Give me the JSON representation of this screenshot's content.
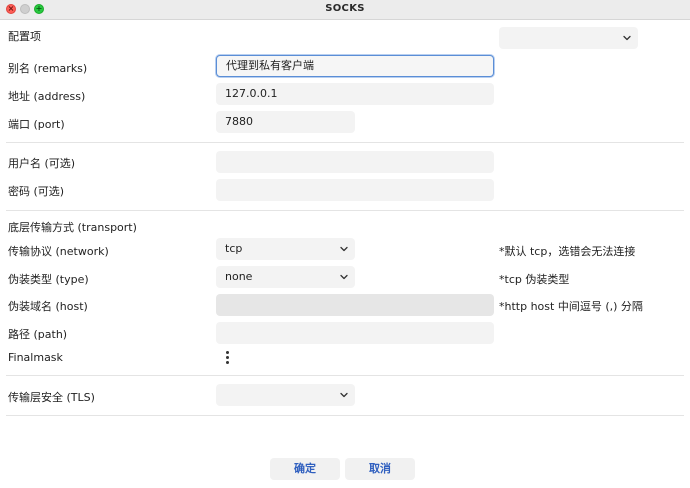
{
  "window": {
    "title": "SOCKS"
  },
  "config": {
    "label": "配置项",
    "select_value": "",
    "remarks": {
      "label": "别名 (remarks)",
      "value": "代理到私有客户端"
    },
    "address": {
      "label": "地址 (address)",
      "value": "127.0.0.1"
    },
    "port": {
      "label": "端口 (port)",
      "value": "7880"
    }
  },
  "auth": {
    "username": {
      "label": "用户名 (可选)",
      "value": ""
    },
    "password": {
      "label": "密码 (可选)",
      "value": ""
    }
  },
  "transport": {
    "section_label": "底层传输方式 (transport)",
    "network": {
      "label": "传输协议 (network)",
      "value": "tcp",
      "hint": "*默认 tcp，选错会无法连接"
    },
    "type": {
      "label": "伪装类型 (type)",
      "value": "none",
      "hint": "*tcp 伪装类型"
    },
    "host": {
      "label": "伪装域名 (host)",
      "value": "",
      "hint": "*http host 中间逗号 (,) 分隔"
    },
    "path": {
      "label": "路径 (path)",
      "value": ""
    },
    "finalmask": {
      "label": "Finalmask"
    }
  },
  "tls": {
    "label": "传输层安全 (TLS)",
    "value": ""
  },
  "buttons": {
    "ok": "确定",
    "cancel": "取消"
  },
  "icons": {
    "more": "more-vertical-icon",
    "chevron": "chevron-down-icon"
  },
  "colors": {
    "close": "#fe5f57",
    "maximize": "#28c840",
    "focus_border": "#5b8ed6",
    "button_text": "#2f5fbf"
  }
}
